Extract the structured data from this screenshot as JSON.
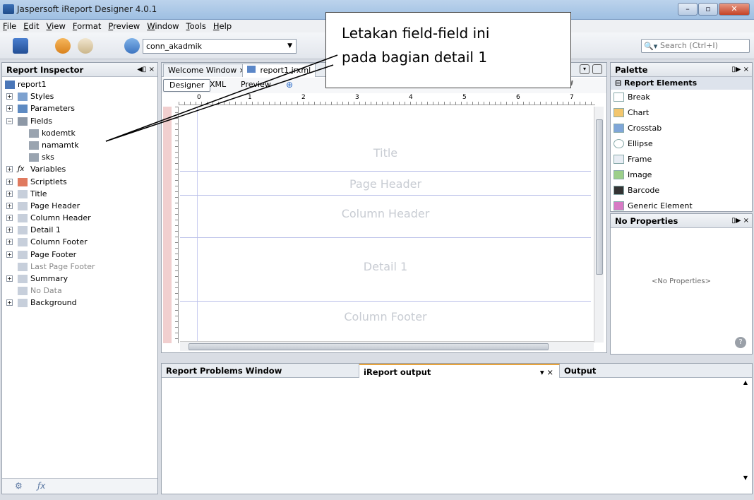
{
  "window": {
    "title": "Jaspersoft iReport Designer 4.0.1",
    "controls": [
      "–",
      "▫",
      "✕"
    ]
  },
  "menu": [
    "File",
    "Edit",
    "View",
    "Format",
    "Preview",
    "Window",
    "Tools",
    "Help"
  ],
  "toolbar": {
    "connection": "conn_akadmik",
    "search_placeholder": "Search (Ctrl+I)"
  },
  "inspector": {
    "title": "Report Inspector",
    "controls": "◀▯ ×",
    "tree": [
      {
        "label": "report1",
        "level": 0,
        "icon": "report-icon"
      },
      {
        "label": "Styles",
        "level": 1,
        "icon": "styles-icon",
        "expand": "+"
      },
      {
        "label": "Parameters",
        "level": 1,
        "icon": "parameters-icon",
        "expand": "+"
      },
      {
        "label": "Fields",
        "level": 1,
        "icon": "fields-icon",
        "expand": "−"
      },
      {
        "label": "kodemtk",
        "level": 2,
        "icon": "field-icon"
      },
      {
        "label": "namamtk",
        "level": 2,
        "icon": "field-icon"
      },
      {
        "label": "sks",
        "level": 2,
        "icon": "field-icon"
      },
      {
        "label": "Variables",
        "level": 1,
        "icon": "variables-icon",
        "expand": "+"
      },
      {
        "label": "Scriptlets",
        "level": 1,
        "icon": "scriptlets-icon",
        "expand": "+"
      },
      {
        "label": "Title",
        "level": 1,
        "icon": "band-icon",
        "expand": "+"
      },
      {
        "label": "Page Header",
        "level": 1,
        "icon": "band-icon",
        "expand": "+"
      },
      {
        "label": "Column Header",
        "level": 1,
        "icon": "band-icon",
        "expand": "+"
      },
      {
        "label": "Detail 1",
        "level": 1,
        "icon": "band-icon",
        "expand": "+"
      },
      {
        "label": "Column Footer",
        "level": 1,
        "icon": "band-icon",
        "expand": "+"
      },
      {
        "label": "Page Footer",
        "level": 1,
        "icon": "band-icon",
        "expand": "+"
      },
      {
        "label": "Last Page Footer",
        "level": 1,
        "icon": "band-icon",
        "muted": true
      },
      {
        "label": "Summary",
        "level": 1,
        "icon": "band-icon",
        "expand": "+"
      },
      {
        "label": "No Data",
        "level": 1,
        "icon": "band-icon",
        "muted": true
      },
      {
        "label": "Background",
        "level": 1,
        "icon": "band-icon",
        "expand": "+"
      }
    ]
  },
  "editor": {
    "tabs": [
      "Welcome Window ×",
      "report1.jrxml"
    ],
    "subtabs": [
      "Designer",
      "XML",
      "Preview"
    ],
    "ruler_numbers": [
      "0",
      "1",
      "2",
      "3",
      "4",
      "5",
      "6",
      "7"
    ],
    "bands": [
      "Title",
      "Page Header",
      "Column Header",
      "Detail 1",
      "Column Footer"
    ]
  },
  "palette": {
    "title": "Palette",
    "controls": "▯▶ ×",
    "category": "Report Elements",
    "items": [
      "Break",
      "Chart",
      "Crosstab",
      "Ellipse",
      "Frame",
      "Image",
      "Barcode",
      "Generic Element"
    ]
  },
  "properties": {
    "title": "No Properties",
    "controls": "▯▶ ×",
    "empty_text": "<No Properties>"
  },
  "output": {
    "tabs": [
      "Report Problems Window",
      "iReport output",
      "Output"
    ],
    "active_tab_controls": "▾ ×"
  },
  "callout": {
    "line1": "Letakan field-field ini",
    "line2": "pada bagian detail 1"
  },
  "colors": {
    "titlebar": "#9ebfe2",
    "output_tab_accent": "#e8a33a",
    "band_text": "#c8ccd3"
  }
}
